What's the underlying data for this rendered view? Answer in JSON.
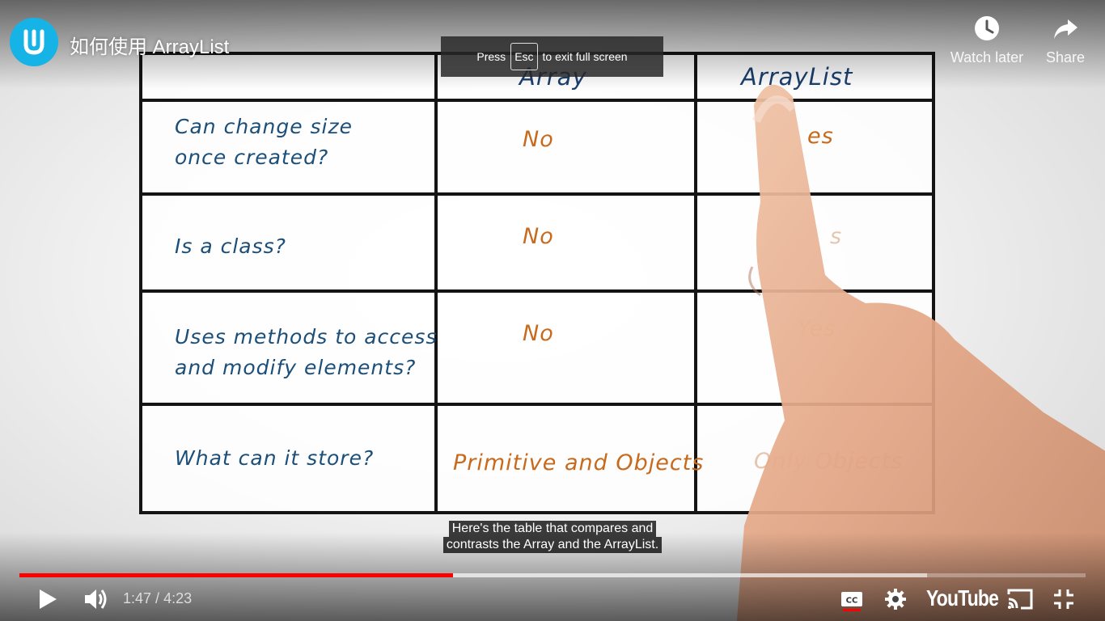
{
  "video": {
    "title": "如何使用 ArrayList",
    "channel_logo_letter": "U"
  },
  "top_actions": {
    "watch_later_label": "Watch later",
    "share_label": "Share"
  },
  "fullscreen_notice": {
    "press": "Press",
    "key": "Esc",
    "message": "to exit full screen"
  },
  "whiteboard": {
    "headers": [
      "Array",
      "ArrayList"
    ],
    "rows": [
      {
        "question": "Can change size\nonce created?",
        "array": "No",
        "arraylist": "es"
      },
      {
        "question": "Is a class?",
        "array": "No",
        "arraylist": "s"
      },
      {
        "question": "Uses methods to access\nand modify elements?",
        "array": "No",
        "arraylist": "Yes"
      },
      {
        "question": "What can it store?",
        "array": "Primitive and Objects",
        "arraylist": "Only Objects"
      }
    ]
  },
  "captions": {
    "line1": "Here's the table that compares and",
    "line2": "contrasts the Array and the ArrayList."
  },
  "player": {
    "current_time": "1:47",
    "separator": " / ",
    "duration": "4:23",
    "played_fraction": 0.407,
    "loaded_fraction": 0.851,
    "brand": "YouTube",
    "accent_color": "#ff0000",
    "icons": [
      "play-icon",
      "volume-icon",
      "captions-icon",
      "settings-icon",
      "cast-icon",
      "exit-fullscreen-icon",
      "clock-icon",
      "share-icon"
    ]
  }
}
